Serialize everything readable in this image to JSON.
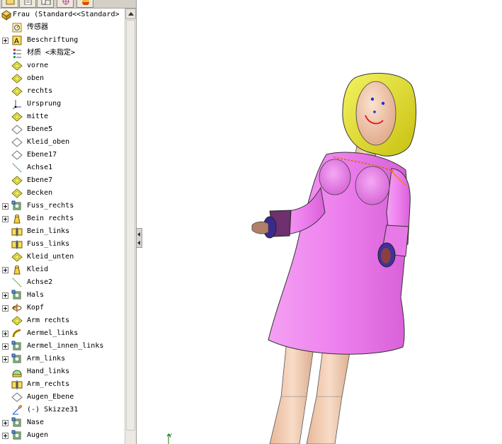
{
  "tree": {
    "root_label": "Frau  (Standard<<Standard>",
    "items": [
      {
        "label": "传感器",
        "icon": "sensor-icon",
        "expandable": false
      },
      {
        "label": "Beschriftung",
        "icon": "annotation-icon",
        "expandable": true
      },
      {
        "label": "材质 <未指定>",
        "icon": "material-icon",
        "expandable": false
      },
      {
        "label": "vorne",
        "icon": "plane-icon",
        "expandable": false
      },
      {
        "label": "oben",
        "icon": "plane-icon",
        "expandable": false
      },
      {
        "label": "rechts",
        "icon": "plane-icon",
        "expandable": false
      },
      {
        "label": "Ursprung",
        "icon": "origin-icon",
        "expandable": false
      },
      {
        "label": "mitte",
        "icon": "plane-icon",
        "expandable": false
      },
      {
        "label": "Ebene5",
        "icon": "plane-outline-icon",
        "expandable": false
      },
      {
        "label": "Kleid_oben",
        "icon": "plane-outline-icon",
        "expandable": false
      },
      {
        "label": "Ebene17",
        "icon": "plane-outline-icon",
        "expandable": false
      },
      {
        "label": "Achse1",
        "icon": "axis-icon",
        "expandable": false
      },
      {
        "label": "Ebene7",
        "icon": "plane-icon",
        "expandable": false
      },
      {
        "label": "Becken",
        "icon": "plane-icon",
        "expandable": false
      },
      {
        "label": "Fuss_rechts",
        "icon": "boss-extrude-icon",
        "expandable": true
      },
      {
        "label": "Bein rechts",
        "icon": "loft-icon",
        "expandable": true
      },
      {
        "label": "Bein_links",
        "icon": "mirror-icon",
        "expandable": false
      },
      {
        "label": "Fuss_links",
        "icon": "mirror-icon",
        "expandable": false
      },
      {
        "label": "Kleid_unten",
        "icon": "plane-icon",
        "expandable": false
      },
      {
        "label": "Kleid",
        "icon": "loft-icon",
        "expandable": true
      },
      {
        "label": "Achse2",
        "icon": "axis-icon",
        "expandable": false
      },
      {
        "label": "Hals",
        "icon": "boss-extrude-icon",
        "expandable": true
      },
      {
        "label": "Kopf",
        "icon": "revolve-icon",
        "expandable": true
      },
      {
        "label": "Arm rechts",
        "icon": "plane-icon",
        "expandable": false
      },
      {
        "label": "Aermel_links",
        "icon": "sweep-icon",
        "expandable": true
      },
      {
        "label": "Aermel_innen_links",
        "icon": "boss-extrude-icon",
        "expandable": true
      },
      {
        "label": "Arm_links",
        "icon": "boss-extrude-icon",
        "expandable": true
      },
      {
        "label": "Hand_links",
        "icon": "dome-icon",
        "expandable": false
      },
      {
        "label": "Arm_rechts",
        "icon": "mirror-icon",
        "expandable": false
      },
      {
        "label": "Augen_Ebene",
        "icon": "plane-outline-icon",
        "expandable": false
      },
      {
        "label": "(-) Skizze31",
        "icon": "sketch-icon",
        "expandable": false
      },
      {
        "label": "Nase",
        "icon": "boss-extrude-icon",
        "expandable": true
      },
      {
        "label": "Augen",
        "icon": "boss-extrude-icon",
        "expandable": true
      }
    ]
  },
  "tabs": [
    {
      "icon": "feature-manager-icon"
    },
    {
      "icon": "property-manager-icon"
    },
    {
      "icon": "configuration-manager-icon"
    },
    {
      "icon": "dimxpert-icon"
    },
    {
      "icon": "display-manager-icon"
    }
  ],
  "viewport": {
    "triad_axis_label": "Y"
  },
  "colors": {
    "dress": "#ee80ee",
    "skin": "#f2c8a8",
    "hair": "#e6e62a",
    "sleeve_dark": "#7a3a7a",
    "eye": "#2030d0",
    "mouth": "#e02020"
  }
}
